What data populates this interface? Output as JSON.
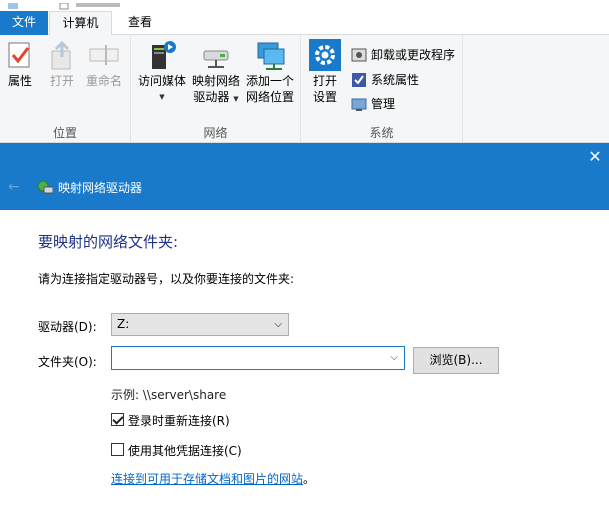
{
  "ribbon": {
    "tabs": [
      {
        "label": "文件"
      },
      {
        "label": "计算机"
      },
      {
        "label": "查看"
      }
    ],
    "groups": {
      "location": {
        "title": "位置",
        "properties": "属性",
        "open": "打开",
        "rename": "重命名"
      },
      "network": {
        "title": "网络",
        "access_media": "访问媒体",
        "map_drive_line1": "映射网络",
        "map_drive_line2": "驱动器",
        "add_location_line1": "添加一个",
        "add_location_line2": "网络位置"
      },
      "system": {
        "title": "系统",
        "open_settings_line1": "打开",
        "open_settings_line2": "设置",
        "uninstall": "卸载或更改程序",
        "system_properties": "系统属性",
        "manage": "管理"
      }
    }
  },
  "dialog": {
    "title": "映射网络驱动器",
    "heading": "要映射的网络文件夹:",
    "instruction": "请为连接指定驱动器号，以及你要连接的文件夹:",
    "drive_label": "驱动器(D):",
    "drive_value": "Z:",
    "folder_label": "文件夹(O):",
    "folder_value": "",
    "browse_label": "浏览(B)...",
    "example": "示例: \\\\server\\share",
    "reconnect_label": "登录时重新连接(R)",
    "reconnect_checked": true,
    "other_cred_label": "使用其他凭据连接(C)",
    "other_cred_checked": false,
    "link_text": "连接到可用于存储文档和图片的网站",
    "link_suffix": "。"
  },
  "colors": {
    "accent": "#1979ca",
    "heading": "#1e3287",
    "link": "#0066cc"
  }
}
